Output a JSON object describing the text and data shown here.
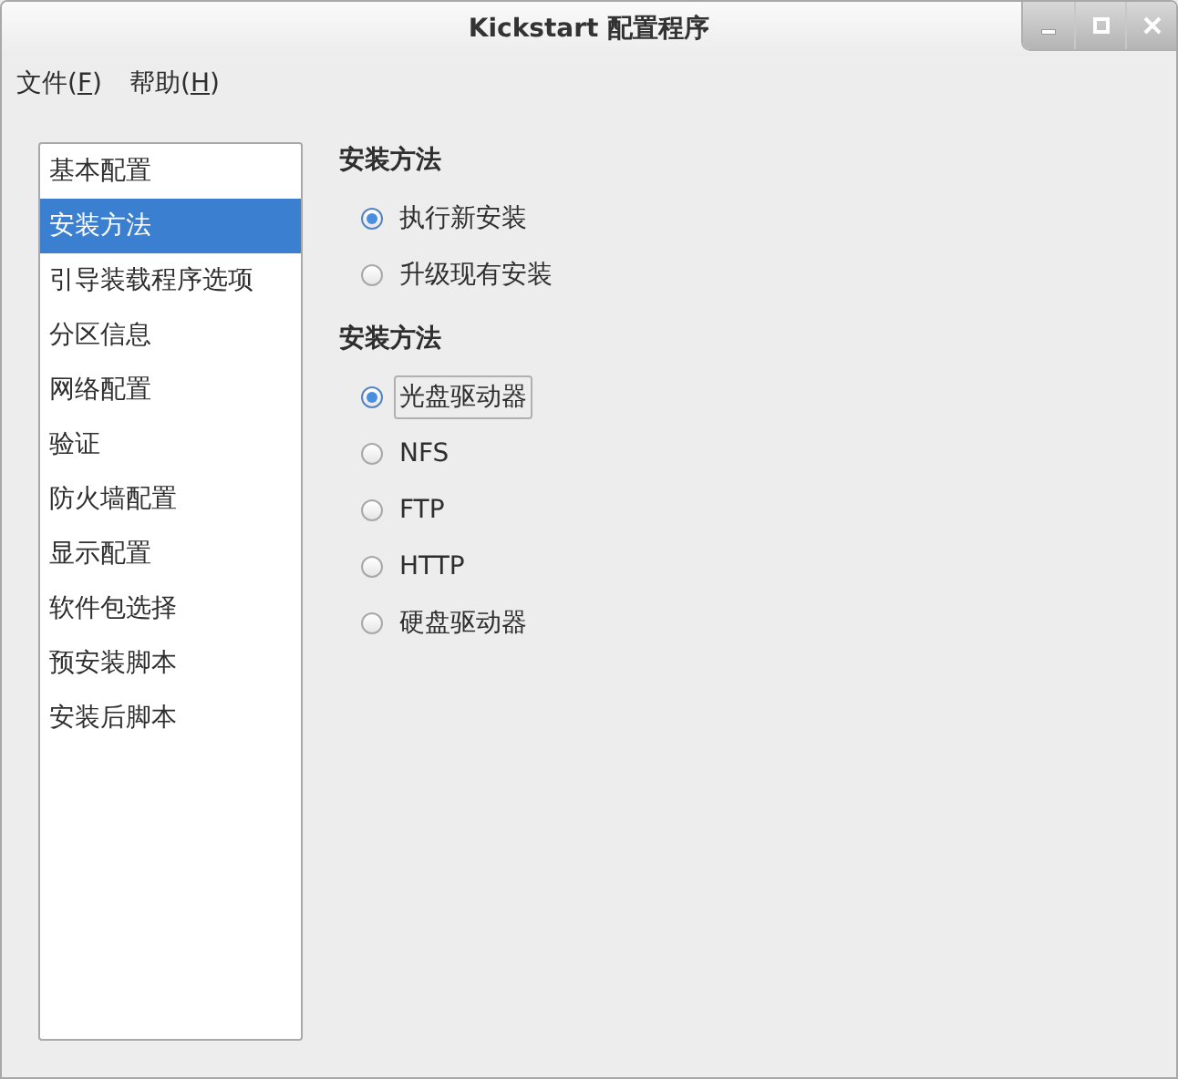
{
  "window": {
    "title": "Kickstart 配置程序"
  },
  "menu": [
    {
      "before": "文件(",
      "key": "F",
      "after": ")"
    },
    {
      "before": "帮助(",
      "key": "H",
      "after": ")"
    }
  ],
  "sidebar": {
    "items": [
      {
        "label": "基本配置",
        "selected": false
      },
      {
        "label": "安装方法",
        "selected": true
      },
      {
        "label": "引导装载程序选项",
        "selected": false
      },
      {
        "label": "分区信息",
        "selected": false
      },
      {
        "label": "网络配置",
        "selected": false
      },
      {
        "label": "验证",
        "selected": false
      },
      {
        "label": "防火墙配置",
        "selected": false
      },
      {
        "label": "显示配置",
        "selected": false
      },
      {
        "label": "软件包选择",
        "selected": false
      },
      {
        "label": "预安装脚本",
        "selected": false
      },
      {
        "label": "安装后脚本",
        "selected": false
      }
    ]
  },
  "sections": [
    {
      "heading": "安装方法",
      "options": [
        {
          "label": "执行新安装",
          "selected": true,
          "focused": false
        },
        {
          "label": "升级现有安装",
          "selected": false,
          "focused": false
        }
      ]
    },
    {
      "heading": "安装方法",
      "options": [
        {
          "label": "光盘驱动器",
          "selected": true,
          "focused": true
        },
        {
          "label": "NFS",
          "selected": false,
          "focused": false
        },
        {
          "label": "FTP",
          "selected": false,
          "focused": false
        },
        {
          "label": "HTTP",
          "selected": false,
          "focused": false
        },
        {
          "label": "硬盘驱动器",
          "selected": false,
          "focused": false
        }
      ]
    }
  ]
}
